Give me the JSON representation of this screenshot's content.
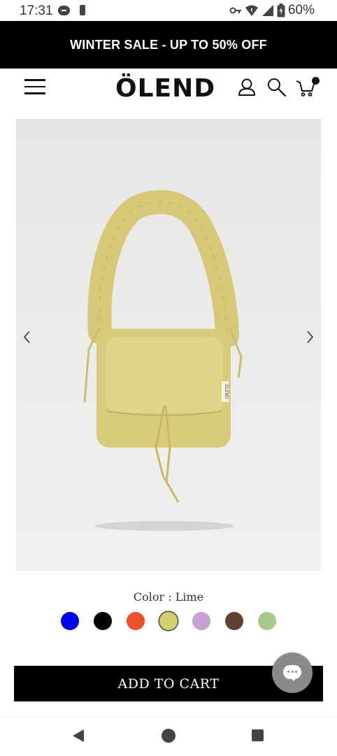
{
  "status_bar": {
    "time": "17:31",
    "battery": "60%",
    "icons": [
      "line-app-icon",
      "download-icon",
      "vpn-key-icon",
      "wifi-icon",
      "signal-icon",
      "battery-icon"
    ]
  },
  "promo_banner": {
    "text": "WINTER SALE - UP TO 50% OFF"
  },
  "header": {
    "logo": "ÖLEND",
    "icons": [
      "menu-icon",
      "account-icon",
      "search-icon",
      "cart-icon"
    ]
  },
  "product": {
    "image": {
      "icon": "lime-bag-image",
      "tag_text": "ÖLEND"
    },
    "color_label": "Color : Lime",
    "colors": [
      {
        "name": "Blue",
        "hex": "#0000ee"
      },
      {
        "name": "Black",
        "hex": "#000000"
      },
      {
        "name": "Orange",
        "hex": "#f0502c"
      },
      {
        "name": "Lime",
        "hex": "#d3cf6c",
        "selected": true
      },
      {
        "name": "Lilac",
        "hex": "#c8a0d4"
      },
      {
        "name": "Brown",
        "hex": "#5e4130"
      },
      {
        "name": "Green",
        "hex": "#a8c98c"
      }
    ]
  },
  "add_to_cart": {
    "label": "ADD TO CART"
  },
  "nav": {
    "icons": [
      "back-icon",
      "home-icon",
      "recents-icon"
    ]
  }
}
